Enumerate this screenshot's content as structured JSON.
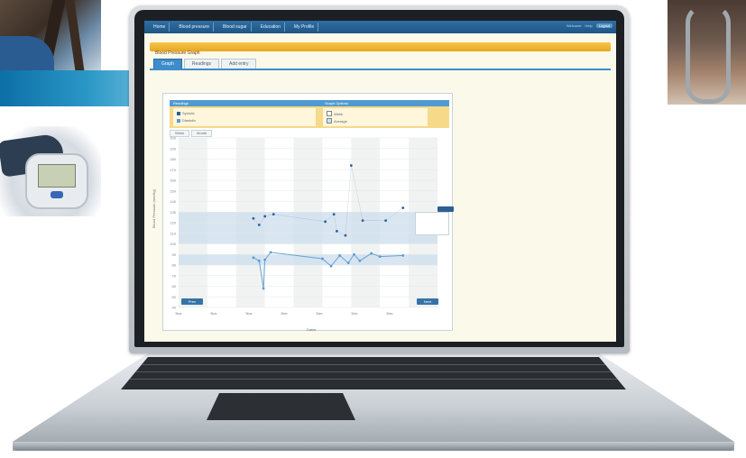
{
  "photos": {
    "top_left": "photo-of-person-with-cuff",
    "blood_pressure_monitor": "photo-of-bp-monitor",
    "top_right": "photo-of-stethoscope"
  },
  "colors": {
    "nav": "#1e5585",
    "orange_bar": "#e9a521",
    "tab_active": "#3e8ccb",
    "band": "#0c6fa6",
    "systolic": "#2f5f9a",
    "diastolic": "#5a9bd0"
  },
  "app": {
    "nav_tabs": [
      "Home",
      "Blood pressure",
      "Blood sugar",
      "Education",
      "My Profile"
    ],
    "nav_right": [
      "Welcome",
      "Help",
      "Logout"
    ],
    "section_title": "Blood Pressure Graph",
    "sub_tabs": [
      "Graph",
      "Readings",
      "Add entry"
    ],
    "instructions": "",
    "legend": {
      "head_left": "Readings",
      "head_right": "Graph Options",
      "items_left": [
        "Systolic",
        "Diastolic"
      ],
      "items_right": [
        "Week",
        "Average"
      ]
    },
    "mini_tabs": [
      "Week",
      "Month"
    ],
    "buttons": {
      "prev": "Prev",
      "next": "Next"
    },
    "tooltip": {
      "line1": "",
      "line2": "",
      "line3": ""
    },
    "x_ticks": [
      "Nov",
      "Nov",
      "Nov",
      "Dec",
      "Dec",
      "Dec",
      "Dec"
    ],
    "x_title": "Dates",
    "y_title": "Blood Pressure (mmHg)"
  },
  "chart_data": {
    "type": "line",
    "y_ticks": [
      40,
      50,
      60,
      70,
      80,
      90,
      100,
      110,
      120,
      130,
      140,
      150,
      160,
      170,
      180,
      190,
      200
    ],
    "ylim": [
      40,
      200
    ],
    "bands": [
      [
        80,
        90
      ],
      [
        100,
        130
      ]
    ],
    "series": [
      {
        "name": "Systolic",
        "points": [
          [
            2.6,
            124
          ],
          [
            2.8,
            118
          ],
          [
            3.0,
            126
          ],
          [
            3.3,
            128
          ],
          [
            5.1,
            121
          ],
          [
            5.4,
            128
          ],
          [
            5.5,
            112
          ],
          [
            5.8,
            108
          ],
          [
            6.0,
            174
          ],
          [
            6.4,
            122
          ],
          [
            7.2,
            122
          ],
          [
            7.8,
            134
          ]
        ]
      },
      {
        "name": "Diastolic",
        "points": [
          [
            2.6,
            87
          ],
          [
            2.8,
            84
          ],
          [
            2.95,
            58
          ],
          [
            3.0,
            85
          ],
          [
            3.2,
            92
          ],
          [
            5.0,
            86
          ],
          [
            5.3,
            79
          ],
          [
            5.6,
            89
          ],
          [
            5.9,
            82
          ],
          [
            6.1,
            90
          ],
          [
            6.3,
            84
          ],
          [
            6.7,
            91
          ],
          [
            7.0,
            88
          ],
          [
            7.8,
            89
          ]
        ]
      }
    ]
  }
}
